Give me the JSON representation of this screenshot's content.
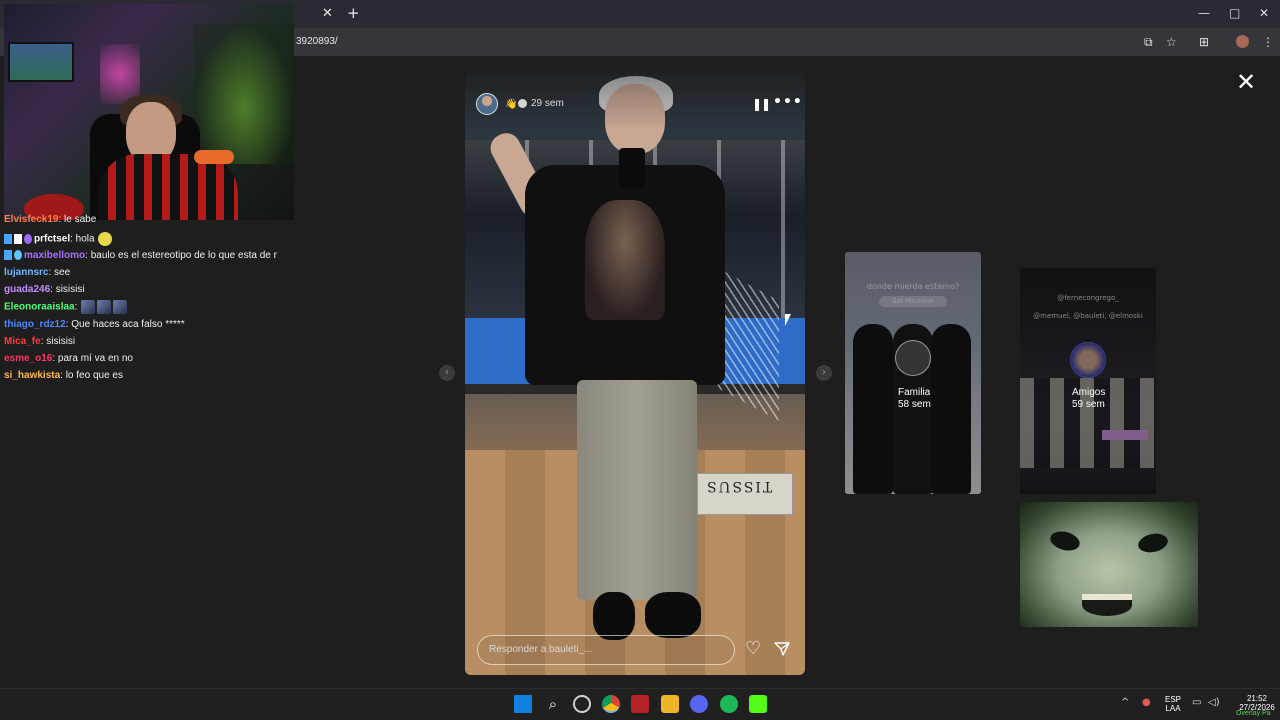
{
  "browser": {
    "url": "3920893/",
    "tab_close_icon": "close-icon",
    "new_tab_label": "+",
    "window_controls": [
      "—",
      "□",
      "✕"
    ]
  },
  "chat": {
    "messages": [
      {
        "user": "Elvisfeck19",
        "text": ": le sabe",
        "color": "#ff7f50"
      },
      {
        "user": "prfctsel",
        "text": ": hola",
        "color": "#ffffff",
        "badges": true,
        "emotes": 1
      },
      {
        "user": "maxibellomo",
        "text": ": baulo es el estereotipo de lo que esta de r",
        "color": "#a970ff",
        "badges": true
      },
      {
        "user": "lujannsrc",
        "text": ": see",
        "color": "#6fb7ff"
      },
      {
        "user": "guada246",
        "text": ": sisisisi",
        "color": "#c48cff"
      },
      {
        "user": "Eleonoraaislaa",
        "text": ":",
        "color": "#4cff7a",
        "emotes": 3
      },
      {
        "user": "thiago_rdz12",
        "text": ": Que haces aca falso *****",
        "color": "#4c88ff"
      },
      {
        "user": "Mica_fe",
        "text": ": sisisisi",
        "color": "#ff3b3b"
      },
      {
        "user": "esme_o16",
        "text": ": para mí va en no",
        "color": "#ff3366"
      },
      {
        "user": "si_hawkista",
        "text": ": lo feo que es",
        "color": "#ffb84c"
      }
    ]
  },
  "story": {
    "emoji": "👋",
    "time": "29 sem",
    "pause_label": "❚❚",
    "more_label": "•••",
    "reply_placeholder": "Responder a bauleti_...",
    "box_text": "TISSUS",
    "close_label": "✕"
  },
  "highlights": [
    {
      "title": "Familia",
      "sub": "58 sem",
      "caption": "donde mierda estamo?",
      "tag": "Sol Micellen"
    },
    {
      "title": "Amigos",
      "sub": "59 sem",
      "caption_1": "@fernecongrego_",
      "caption_2": "@memuel, @bauleti, @elmoski"
    }
  ],
  "nav": {
    "prev": "‹",
    "next": "›"
  },
  "taskbar": {
    "lang_top": "ESP",
    "lang_bottom": "LAA",
    "time": "21:52",
    "date": "27/2/2026",
    "overlay_label": "Overlay Pa"
  },
  "colors": {
    "page_bg": "#1d1e1d",
    "chrome_bg": "#2b2a33",
    "taskbar_bg": "#202020",
    "accent": "#7aa8ff"
  }
}
